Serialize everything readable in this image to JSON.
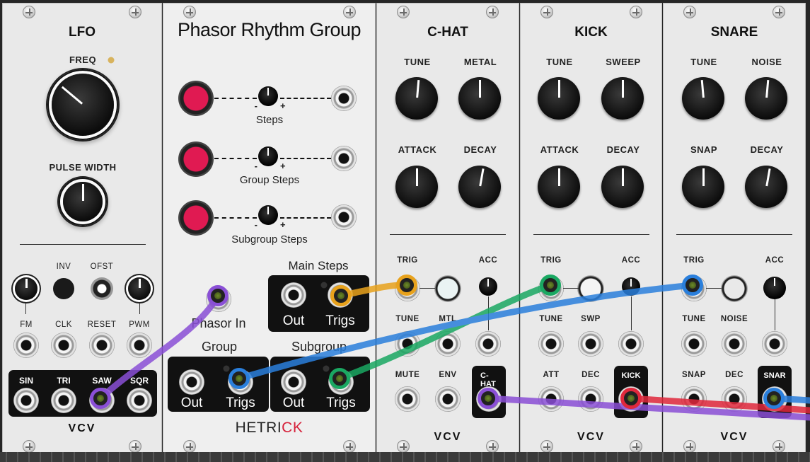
{
  "lfo": {
    "title": "LFO",
    "freq_label": "FREQ",
    "pulse_width_label": "PULSE WIDTH",
    "inv_label": "INV",
    "ofst_label": "OFST",
    "fm_label": "FM",
    "clk_label": "CLK",
    "reset_label": "RESET",
    "pwm_label": "PWM",
    "sin_label": "SIN",
    "tri_label": "TRI",
    "saw_label": "SAW",
    "sqr_label": "SQR",
    "brand": "VCV"
  },
  "phasor": {
    "title": "Phasor Rhythm Group",
    "steps_label": "Steps",
    "group_steps_label": "Group Steps",
    "subgroup_steps_label": "Subgroup Steps",
    "minus": "-",
    "plus": "+",
    "main_steps_label": "Main Steps",
    "phasor_in_label": "Phasor In",
    "group_label": "Group",
    "subgroup_label": "Subgroup",
    "out_label": "Out",
    "trigs_label": "Trigs",
    "brand_main": "HETRI",
    "brand_accent": "CK"
  },
  "chat": {
    "title": "C-HAT",
    "tune_label": "TUNE",
    "metal_label": "METAL",
    "attack_label": "ATTACK",
    "decay_label": "DECAY",
    "trig_label": "TRIG",
    "acc_label": "ACC",
    "tune_in_label": "TUNE",
    "mtl_label": "MTL",
    "mute_label": "MUTE",
    "env_label": "ENV",
    "out_label": "C-HAT",
    "brand": "VCV"
  },
  "kick": {
    "title": "KICK",
    "tune_label": "TUNE",
    "sweep_label": "SWEEP",
    "attack_label": "ATTACK",
    "decay_label": "DECAY",
    "trig_label": "TRIG",
    "acc_label": "ACC",
    "tune_in_label": "TUNE",
    "swp_label": "SWP",
    "att_label": "ATT",
    "dec_label": "DEC",
    "out_label": "KICK",
    "brand": "VCV"
  },
  "snare": {
    "title": "SNARE",
    "tune_label": "TUNE",
    "noise_label": "NOISE",
    "snap_label": "SNAP",
    "decay_label": "DECAY",
    "trig_label": "TRIG",
    "acc_label": "ACC",
    "tune_in_label": "TUNE",
    "noise_in_label": "NOISE",
    "snap_in_label": "SNAP",
    "dec_label": "DEC",
    "out_label": "SNAR",
    "brand": "VCV"
  },
  "colors": {
    "cable_purple": "#8a4fd6",
    "cable_orange": "#e8a21c",
    "cable_green": "#1aa862",
    "cable_blue": "#2a7fdc",
    "cable_red": "#e0283c",
    "accent_red": "#d6213a"
  }
}
